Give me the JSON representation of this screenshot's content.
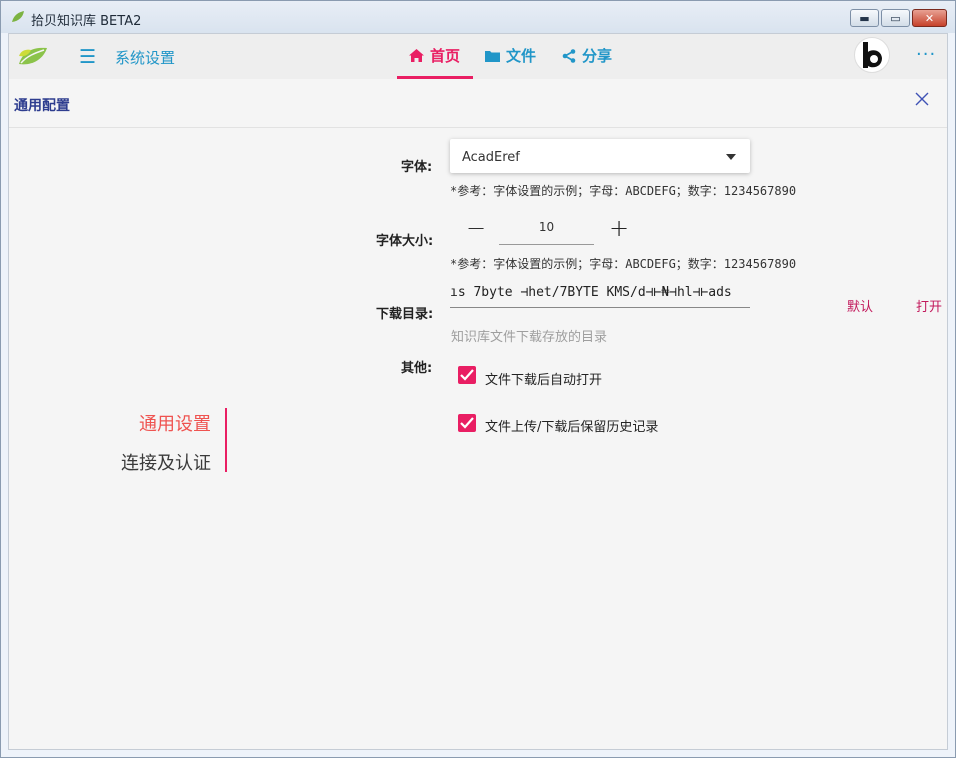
{
  "window": {
    "title": "拾贝知识库 BETA2",
    "min_glyph": "▬",
    "max_glyph": "▭",
    "close_glyph": "✕"
  },
  "topbar": {
    "menu_icon": "☰",
    "system_settings": "系统设置",
    "nav": [
      {
        "label": "首页",
        "icon": "home-icon",
        "active": true
      },
      {
        "label": "文件",
        "icon": "folder-icon",
        "active": false
      },
      {
        "label": "分享",
        "icon": "share-icon",
        "active": false
      }
    ],
    "more": "···"
  },
  "panel": {
    "title": "通用配置"
  },
  "sidebar": {
    "items": [
      {
        "label": "通用设置",
        "active": true
      },
      {
        "label": "连接及认证",
        "active": false
      }
    ]
  },
  "form": {
    "font_label": "字体:",
    "font_value": "AcadEref",
    "font_note": "*参考：字体设置的示例；字母：ABCDEFG；数字：1234567890",
    "size_label": "字体大小:",
    "size_minus": "−",
    "size_value": "10",
    "size_plus": "+",
    "size_note": "*参考：字体设置的示例；字母：ABCDEFG；数字：1234567890",
    "dir_label": "下载目录:",
    "dir_value": "ıs  7byte  ⊣het/7BYTE KMS/d⊣⊢₦⊣hl⊣⊢ads",
    "dir_default": "默认",
    "dir_open": "打开",
    "dir_hint": "知识库文件下载存放的目录",
    "other_label": "其他:",
    "opt_auto_open": "文件下载后自动打开",
    "opt_keep_history": "文件上传/下载后保留历史记录"
  },
  "colors": {
    "accent": "#e91e63",
    "link": "#2196c8",
    "title": "#2e3d8f"
  }
}
